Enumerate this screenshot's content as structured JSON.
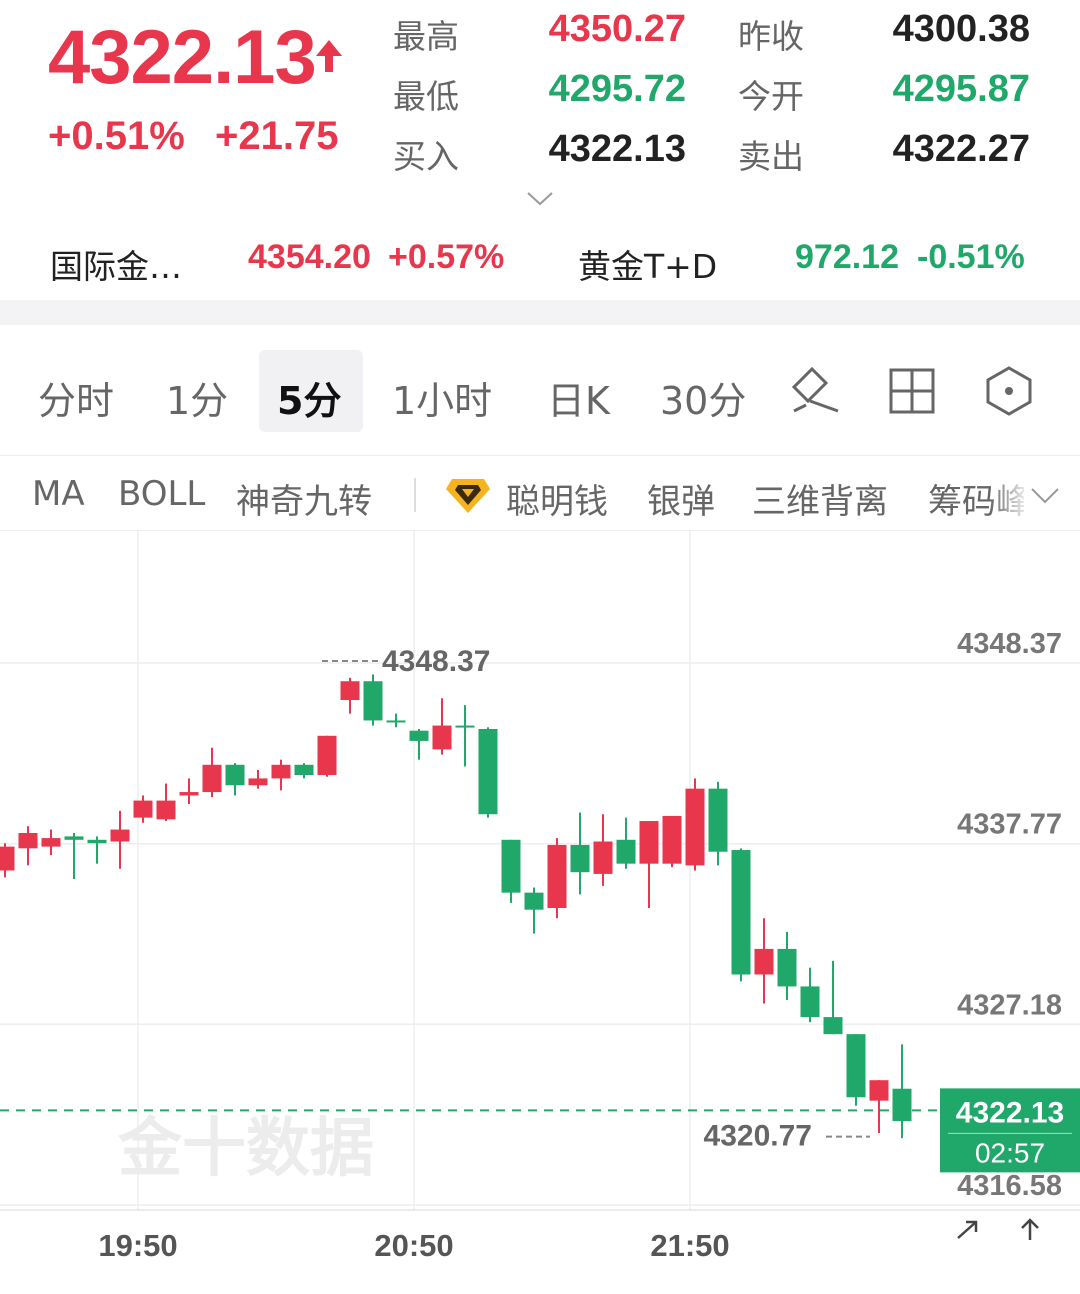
{
  "quote": {
    "price": "4322.13",
    "arrow": "up-arrow-icon",
    "change_pct": "+0.51%",
    "change_abs": "+21.75",
    "high_label": "最高",
    "high": "4350.27",
    "low_label": "最低",
    "low": "4295.72",
    "bid_label": "买入",
    "bid": "4322.13",
    "prev_close_label": "昨收",
    "prev_close": "4300.38",
    "open_label": "今开",
    "open": "4295.87",
    "ask_label": "卖出",
    "ask": "4322.27"
  },
  "related": [
    {
      "name": "国际金…",
      "price": "4354.20",
      "change": "+0.57%",
      "trend": "up"
    },
    {
      "name": "黄金T+D",
      "price": "972.12",
      "change": "-0.51%",
      "trend": "down"
    }
  ],
  "tabs": [
    {
      "label": "分时"
    },
    {
      "label": "1分"
    },
    {
      "label": "5分",
      "active": true
    },
    {
      "label": "1小时"
    },
    {
      "label": "日K"
    },
    {
      "label": "30分"
    }
  ],
  "tab_icons": [
    "draw-icon",
    "grid-layout-icon",
    "settings-hex-icon"
  ],
  "indicators": [
    "MA",
    "BOLL",
    "神奇九转",
    "聪明钱",
    "银弹",
    "三维背离",
    "筹码峰"
  ],
  "indicator_badge_icon": "diamond-badge-icon",
  "watermark": "金十数据",
  "colors": {
    "up": "#e8364c",
    "down": "#20a86a"
  },
  "chart_data": {
    "type": "candlestick",
    "y_ticks": [
      "4348.37",
      "4337.77",
      "4327.18",
      "4316.58"
    ],
    "ylim": [
      4316.58,
      4348.37
    ],
    "x_ticks": [
      "19:50",
      "20:50",
      "21:50"
    ],
    "high_marker": "4348.37",
    "low_marker": "4320.77",
    "current_price": "4322.13",
    "countdown": "02:57",
    "candles": [
      {
        "o": 4336.2,
        "h": 4337.8,
        "l": 4335.8,
        "c": 4337.6
      },
      {
        "o": 4337.5,
        "h": 4338.8,
        "l": 4336.5,
        "c": 4338.4
      },
      {
        "o": 4337.6,
        "h": 4338.6,
        "l": 4337.1,
        "c": 4338.1
      },
      {
        "o": 4338.2,
        "h": 4338.4,
        "l": 4335.7,
        "c": 4338.0
      },
      {
        "o": 4338.0,
        "h": 4338.2,
        "l": 4336.6,
        "c": 4337.8
      },
      {
        "o": 4337.9,
        "h": 4339.7,
        "l": 4336.3,
        "c": 4338.6
      },
      {
        "o": 4339.3,
        "h": 4340.6,
        "l": 4339.0,
        "c": 4340.3
      },
      {
        "o": 4339.2,
        "h": 4341.3,
        "l": 4339.1,
        "c": 4340.3
      },
      {
        "o": 4340.6,
        "h": 4341.6,
        "l": 4340.1,
        "c": 4340.8
      },
      {
        "o": 4340.8,
        "h": 4343.4,
        "l": 4340.5,
        "c": 4342.4
      },
      {
        "o": 4342.4,
        "h": 4342.5,
        "l": 4340.6,
        "c": 4341.2
      },
      {
        "o": 4341.2,
        "h": 4342.1,
        "l": 4341.0,
        "c": 4341.6
      },
      {
        "o": 4341.6,
        "h": 4342.7,
        "l": 4340.9,
        "c": 4342.4
      },
      {
        "o": 4342.4,
        "h": 4342.5,
        "l": 4341.6,
        "c": 4341.8
      },
      {
        "o": 4341.8,
        "h": 4344.1,
        "l": 4341.7,
        "c": 4344.1
      },
      {
        "o": 4346.2,
        "h": 4347.5,
        "l": 4345.4,
        "c": 4347.3
      },
      {
        "o": 4347.3,
        "h": 4347.7,
        "l": 4344.7,
        "c": 4345.0
      },
      {
        "o": 4345.0,
        "h": 4345.4,
        "l": 4344.6,
        "c": 4344.9
      },
      {
        "o": 4344.4,
        "h": 4344.5,
        "l": 4342.7,
        "c": 4343.8
      },
      {
        "o": 4343.3,
        "h": 4346.3,
        "l": 4343.0,
        "c": 4344.7
      },
      {
        "o": 4344.7,
        "h": 4345.9,
        "l": 4342.3,
        "c": 4344.6
      },
      {
        "o": 4344.5,
        "h": 4344.6,
        "l": 4339.3,
        "c": 4339.5
      },
      {
        "o": 4338.0,
        "h": 4338.0,
        "l": 4334.3,
        "c": 4334.9
      },
      {
        "o": 4334.9,
        "h": 4335.2,
        "l": 4332.5,
        "c": 4333.9
      },
      {
        "o": 4334.0,
        "h": 4338.1,
        "l": 4333.4,
        "c": 4337.7
      },
      {
        "o": 4337.7,
        "h": 4339.6,
        "l": 4334.8,
        "c": 4336.1
      },
      {
        "o": 4336.0,
        "h": 4339.5,
        "l": 4335.3,
        "c": 4337.9
      },
      {
        "o": 4338.0,
        "h": 4339.3,
        "l": 4336.3,
        "c": 4336.6
      },
      {
        "o": 4336.6,
        "h": 4339.1,
        "l": 4334.0,
        "c": 4339.1
      },
      {
        "o": 4336.6,
        "h": 4339.4,
        "l": 4336.4,
        "c": 4339.4
      },
      {
        "o": 4336.5,
        "h": 4341.6,
        "l": 4336.2,
        "c": 4341.0
      },
      {
        "o": 4341.0,
        "h": 4341.4,
        "l": 4336.5,
        "c": 4337.3
      },
      {
        "o": 4337.4,
        "h": 4337.5,
        "l": 4329.7,
        "c": 4330.1
      },
      {
        "o": 4330.1,
        "h": 4333.4,
        "l": 4328.4,
        "c": 4331.6
      },
      {
        "o": 4331.6,
        "h": 4332.6,
        "l": 4328.6,
        "c": 4329.4
      },
      {
        "o": 4329.4,
        "h": 4330.5,
        "l": 4327.3,
        "c": 4327.6
      },
      {
        "o": 4327.6,
        "h": 4330.9,
        "l": 4326.6,
        "c": 4326.6
      },
      {
        "o": 4326.6,
        "h": 4326.6,
        "l": 4322.4,
        "c": 4322.9
      },
      {
        "o": 4322.7,
        "h": 4323.9,
        "l": 4320.8,
        "c": 4323.9
      },
      {
        "o": 4323.4,
        "h": 4326.0,
        "l": 4320.5,
        "c": 4321.5
      }
    ]
  }
}
